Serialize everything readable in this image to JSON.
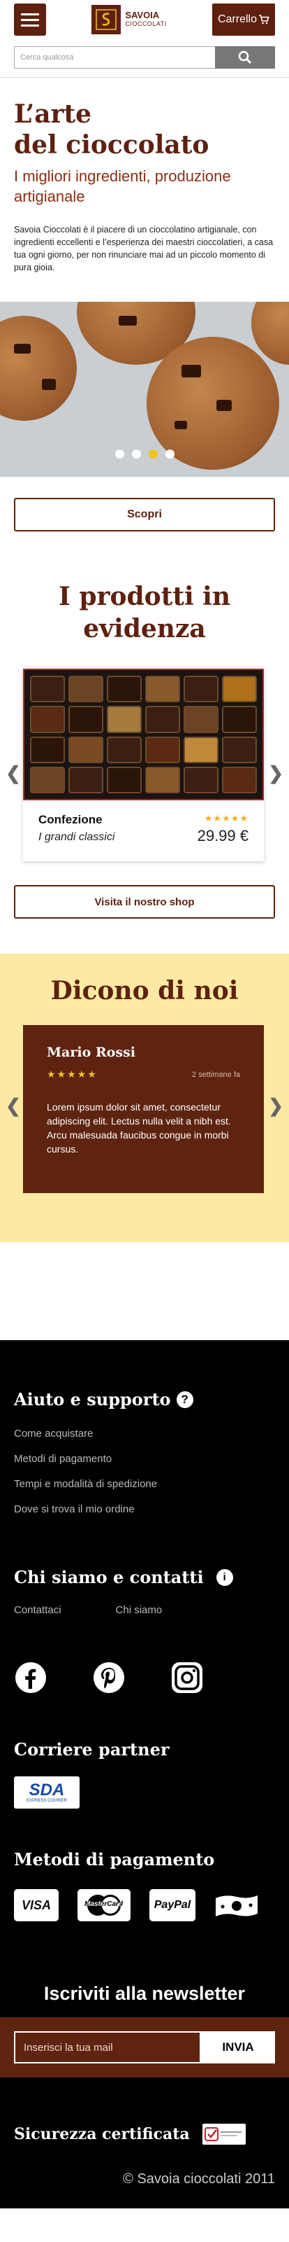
{
  "header": {
    "logo_brand": "SAVOIA",
    "logo_sub": "CIOCCOLATI",
    "cart_label": "Carrello"
  },
  "search": {
    "placeholder": "Cerca qualcosa"
  },
  "hero": {
    "title_line1": "L’arte",
    "title_line2": "del cioccolato",
    "subtitle": "I migliori ingredienti, produzione artigianale",
    "description": "Savoia Cioccolati è il piacere di un cioccolatino artigianale, con ingredienti eccellenti e l’esperienza dei maestri cioccolatieri, a casa tua ogni giorno, per non rinunciare mai ad un piccolo momento di pura gioia.",
    "cta": "Scopri",
    "slides": 4,
    "active_slide": 3
  },
  "featured": {
    "title": "I prodotti in evidenza",
    "product": {
      "name": "Confezione",
      "line": "I grandi classici",
      "price": "29.99 €",
      "rating": 5
    },
    "shop_button": "Visita il nostro shop"
  },
  "testimonials": {
    "title": "Dicono di noi",
    "review": {
      "author": "Mario Rossi",
      "rating": 5,
      "date": "2 settimane fa",
      "text": "Lorem ipsum dolor sit amet, consectetur adipiscing elit. Lectus nulla velit a nibh est. Arcu malesuada faucibus congue in morbi cursus."
    }
  },
  "footer": {
    "support_title": "Aiuto e supporto",
    "support_links": [
      "Come acquistare",
      "Metodi di pagamento",
      "Tempi e modalità di spedizione",
      "Dove si trova il mio ordine"
    ],
    "about_title": "Chi siamo e contatti",
    "about_links": [
      "Contattaci",
      "Chi siamo"
    ],
    "courier_title": "Corriere partner",
    "courier_name": "SDA",
    "courier_tagline": "EXPRESS COURIER",
    "payments_title": "Metodi di pagamento",
    "payments": [
      "VISA",
      "MasterCard",
      "PayPal"
    ],
    "newsletter_title": "Iscriviti alla newsletter",
    "newsletter_placeholder": "Inserisci la tua mail",
    "newsletter_button": "INVIA",
    "security_title": "Sicurezza certificata",
    "copyright": "© Savoia cioccolati 2011"
  },
  "colors": {
    "brand": "#5e2110",
    "accent": "#f0c419",
    "cream": "#fce9a3"
  }
}
